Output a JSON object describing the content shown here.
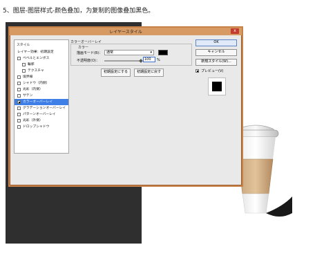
{
  "caption": "5、图层-图层样式-颜色叠加，为复制的图像叠加黑色。",
  "dialog": {
    "title": "レイヤースタイル",
    "close_label": "x",
    "styles_header": "スタイル",
    "styles": [
      {
        "label": "レイヤー効果：初期設定",
        "checkbox": false,
        "checked": false,
        "sub": false,
        "active": false
      },
      {
        "label": "ベベルとエンボス",
        "checkbox": true,
        "checked": false,
        "sub": false,
        "active": false
      },
      {
        "label": "輪郭",
        "checkbox": true,
        "checked": false,
        "sub": true,
        "active": false
      },
      {
        "label": "テクスチャ",
        "checkbox": true,
        "checked": false,
        "sub": true,
        "active": false
      },
      {
        "label": "境界線",
        "checkbox": true,
        "checked": false,
        "sub": false,
        "active": false
      },
      {
        "label": "シャドウ（内側）",
        "checkbox": true,
        "checked": false,
        "sub": false,
        "active": false
      },
      {
        "label": "光彩（内側）",
        "checkbox": true,
        "checked": false,
        "sub": false,
        "active": false
      },
      {
        "label": "サテン",
        "checkbox": true,
        "checked": false,
        "sub": false,
        "active": false
      },
      {
        "label": "カラーオーバーレイ",
        "checkbox": true,
        "checked": true,
        "sub": false,
        "active": true
      },
      {
        "label": "グラデーションオーバーレイ",
        "checkbox": true,
        "checked": false,
        "sub": false,
        "active": false
      },
      {
        "label": "パターンオーバーレイ",
        "checkbox": true,
        "checked": false,
        "sub": false,
        "active": false
      },
      {
        "label": "光彩（外側）",
        "checkbox": true,
        "checked": false,
        "sub": false,
        "active": false
      },
      {
        "label": "ドロップシャドウ",
        "checkbox": true,
        "checked": false,
        "sub": false,
        "active": false
      }
    ],
    "panel": {
      "group_title": "カラーオーバーレイ",
      "subtitle": "カラー",
      "blend_mode_label": "描画モード(B)：",
      "blend_mode_value": "通常",
      "opacity_label": "不透明度(O)：",
      "opacity_value": "100",
      "percent": "%",
      "make_default": "初期設定にする",
      "reset_default": "初期設定に戻す",
      "color": "#000000"
    },
    "buttons": {
      "ok": "OK",
      "cancel": "キャンセル",
      "new_style": "新規スタイル(W)...",
      "preview_label": "プレビュー(V)",
      "preview_checked": true
    }
  }
}
